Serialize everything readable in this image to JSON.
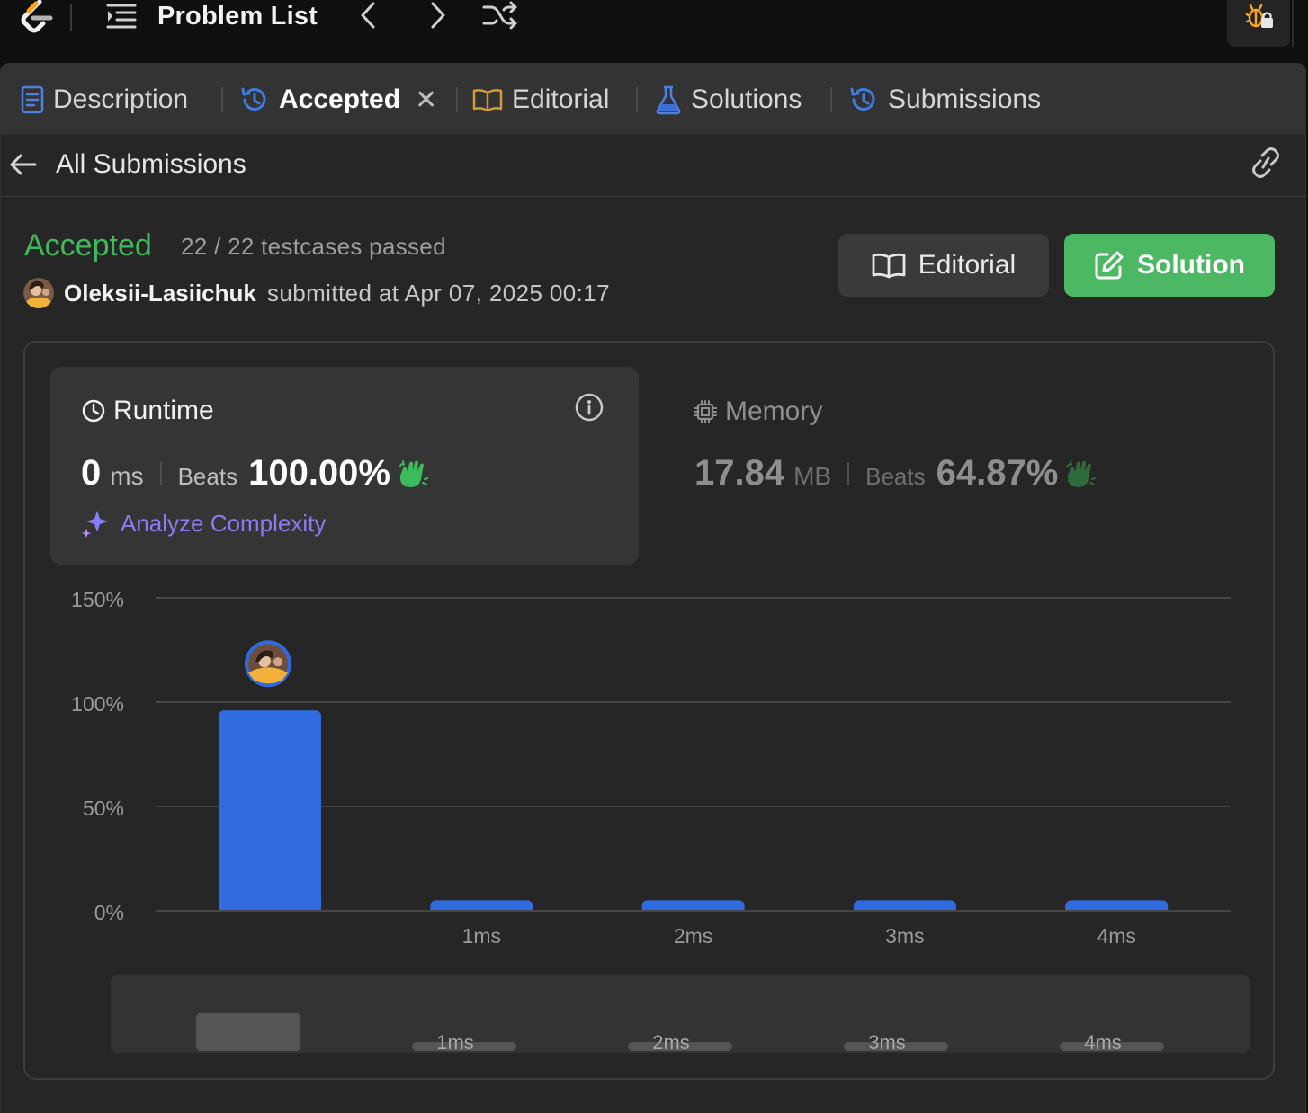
{
  "topbar": {
    "problem_list_label": "Problem List"
  },
  "tabs": [
    {
      "label": "Description"
    },
    {
      "label": "Accepted"
    },
    {
      "label": "Editorial"
    },
    {
      "label": "Solutions"
    },
    {
      "label": "Submissions"
    }
  ],
  "subbar": {
    "back_label": "All Submissions"
  },
  "submission": {
    "status": "Accepted",
    "testcases": "22 / 22 testcases passed",
    "user": "Oleksii-Lasiichuk",
    "submitted_text": "submitted at Apr 07, 2025 00:17"
  },
  "buttons": {
    "editorial": "Editorial",
    "solution": "Solution"
  },
  "runtime": {
    "title": "Runtime",
    "value": "0",
    "unit": "ms",
    "beats_label": "Beats",
    "beats_pct": "100.00%",
    "analyze_label": "Analyze Complexity"
  },
  "memory": {
    "title": "Memory",
    "value": "17.84",
    "unit": "MB",
    "beats_label": "Beats",
    "beats_pct": "64.87%"
  },
  "colors": {
    "accepted": "#3dbb5a",
    "bar": "#2f6bdf",
    "solution_button": "#4cb864",
    "analyze": "#8b7cf6"
  },
  "chart_data": {
    "type": "bar",
    "categories": [
      "0ms",
      "1ms",
      "2ms",
      "3ms",
      "4ms"
    ],
    "values": [
      96,
      5,
      5,
      5,
      5
    ],
    "x_tick_labels": [
      "",
      "1ms",
      "2ms",
      "3ms",
      "4ms"
    ],
    "y_ticks": [
      "0%",
      "50%",
      "100%",
      "150%"
    ],
    "ylim": [
      0,
      150
    ],
    "grid": true,
    "highlight_index": 0,
    "overview_tick_labels": [
      "",
      "1ms",
      "2ms",
      "3ms",
      "4ms"
    ]
  }
}
